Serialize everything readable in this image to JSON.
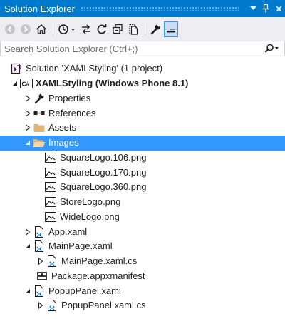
{
  "window": {
    "title": "Solution Explorer"
  },
  "search": {
    "placeholder": "Search Solution Explorer (Ctrl+;)"
  },
  "tree": {
    "solution": "Solution 'XAMLStyling' (1 project)",
    "project": "XAMLStyling (Windows Phone 8.1)",
    "items": {
      "properties": "Properties",
      "references": "References",
      "assets": "Assets",
      "images": "Images",
      "img1": "SquareLogo.106.png",
      "img2": "SquareLogo.170.png",
      "img3": "SquareLogo.360.png",
      "img4": "StoreLogo.png",
      "img5": "WideLogo.png",
      "app": "App.xaml",
      "mainpage": "MainPage.xaml",
      "mainpage_cs": "MainPage.xaml.cs",
      "manifest": "Package.appxmanifest",
      "popup": "PopupPanel.xaml",
      "popup_cs": "PopupPanel.xaml.cs"
    }
  },
  "colors": {
    "titlebar": "#007acc",
    "toolbar": "#eeeef2",
    "selection": "#3399ff",
    "folder": "#dcb67a"
  }
}
